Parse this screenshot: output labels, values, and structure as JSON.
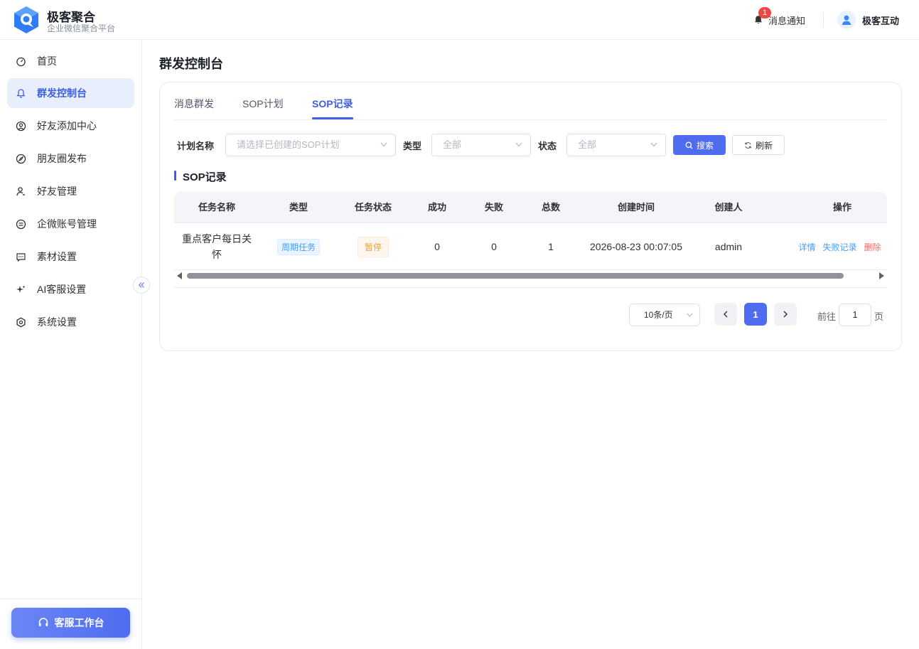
{
  "header": {
    "brand_title": "极客聚合",
    "brand_subtitle": "企业微信聚合平台",
    "notify_label": "消息通知",
    "notify_count": "1",
    "user_name": "极客互动"
  },
  "sidebar": {
    "items": [
      {
        "label": "首页",
        "icon": "dashboard-icon"
      },
      {
        "label": "群发控制台",
        "icon": "bell-icon"
      },
      {
        "label": "好友添加中心",
        "icon": "user-add-icon"
      },
      {
        "label": "朋友圈发布",
        "icon": "compass-icon"
      },
      {
        "label": "好友管理",
        "icon": "user-icon"
      },
      {
        "label": "企微账号管理",
        "icon": "account-icon"
      },
      {
        "label": "素材设置",
        "icon": "message-icon"
      },
      {
        "label": "AI客服设置",
        "icon": "sparkle-icon"
      },
      {
        "label": "系统设置",
        "icon": "gear-icon"
      }
    ],
    "active_index": 1,
    "service_button": "客服工作台"
  },
  "main": {
    "title": "群发控制台",
    "tabs": [
      "消息群发",
      "SOP计划",
      "SOP记录"
    ],
    "active_tab": 2,
    "filters": {
      "plan_label": "计划名称",
      "plan_placeholder": "请选择已创建的SOP计划",
      "type_label": "类型",
      "type_value": "全部",
      "status_label": "状态",
      "status_value": "全部",
      "search_button": "搜索",
      "refresh_button": "刷新"
    },
    "section_title": "SOP记录",
    "table": {
      "columns": [
        "任务名称",
        "类型",
        "任务状态",
        "成功",
        "失败",
        "总数",
        "创建时间",
        "创建人",
        "操作"
      ],
      "rows": [
        {
          "task_name": "重点客户每日关怀",
          "task_name_line1": "重点客户每日关",
          "task_name_line2": "怀",
          "type": "周期任务",
          "status": "暂停",
          "success": "0",
          "failed": "0",
          "total": "1",
          "created_at": "2026-08-23 00:07:05",
          "creator": "admin",
          "actions": [
            "详情",
            "失败记录",
            "删除"
          ]
        }
      ]
    },
    "pagination": {
      "page_size": "10条/页",
      "current_page": "1",
      "goto_prefix": "前往",
      "goto_value": "1",
      "goto_suffix": "页"
    }
  },
  "colors": {
    "primary": "#4f6cf0",
    "active_text": "#3d5fe0",
    "danger": "#f56c6c",
    "warning": "#e6a23c",
    "link": "#409eff"
  }
}
